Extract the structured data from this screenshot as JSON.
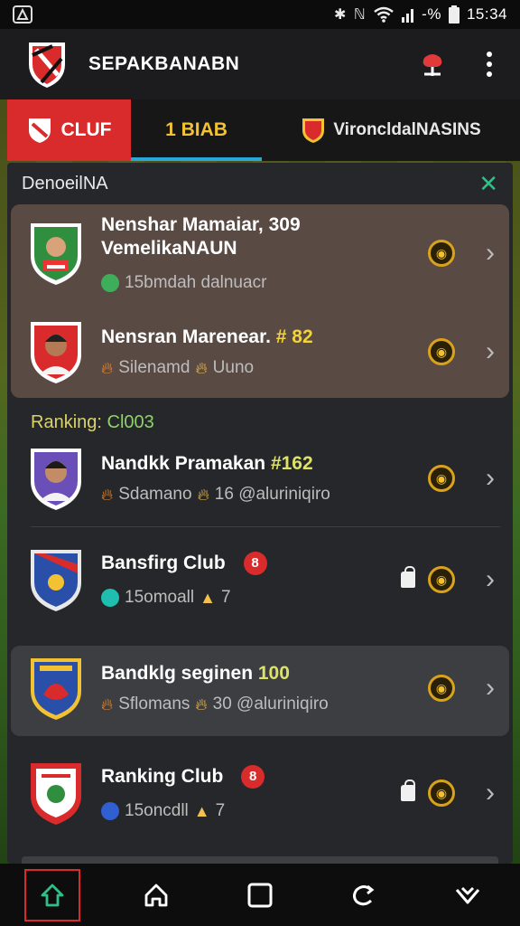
{
  "status_bar": {
    "time": "15:34",
    "battery_text": "-%",
    "icons": [
      "app-notification-icon",
      "bluetooth-icon",
      "signal-icon",
      "wifi-icon",
      "cell-signal-icon",
      "battery-icon"
    ]
  },
  "app_bar": {
    "title": "SEPAKBANABN",
    "icons": [
      "app-logo-shield",
      "pin-icon",
      "more-vert-icon"
    ]
  },
  "tabs": [
    {
      "label": "CLUF",
      "icon": "club-shield-icon",
      "active": true
    },
    {
      "label": "1 BIAB",
      "active": false
    },
    {
      "label": "VironcldalNASINS",
      "icon": "national-shield-icon",
      "active": false
    }
  ],
  "section": {
    "title": "DenoeilNA",
    "close_icon": "close-icon"
  },
  "rows": [
    {
      "title": "Nenshar Mamaiar, 309",
      "title2": "VemelikaNAUN",
      "subtitle": "15bmdah dalnuacr",
      "dot_color": "#3fae5a",
      "medal": "medal-icon"
    },
    {
      "title": "Nensran Marenear.",
      "title_accent": "# 82",
      "subtitle_a": "Silenamd",
      "subtitle_b": "Uuno"
    },
    {
      "title": "Nandkk Pramakan",
      "title_accent": "#162",
      "subtitle_a": "Sdamano",
      "subtitle_b": "16 @aluriniqiro"
    },
    {
      "title": "Bansfirg Club",
      "badge": "8",
      "subtitle_a": "15omoall",
      "subtitle_b": "7",
      "dot_color": "#1fbfb0"
    },
    {
      "title": "Bandklg seginen",
      "title_accent": "100",
      "subtitle_a": "Sflomans",
      "subtitle_b": "30 @aluriniqiro"
    },
    {
      "title": "Ranking Club",
      "badge": "8",
      "subtitle_a": "15oncdll",
      "subtitle_b": "7",
      "dot_color": "#2f5fd0"
    }
  ],
  "ranking_label": {
    "text": "Ranking:",
    "value": "Cl003"
  },
  "nav": [
    "home-active-icon",
    "home-icon",
    "square-icon",
    "refresh-icon",
    "heart-down-icon"
  ],
  "colors": {
    "accent_red": "#d92b2b",
    "tab_underline": "#2aa6d9",
    "medal_gold": "#d9a21c"
  }
}
